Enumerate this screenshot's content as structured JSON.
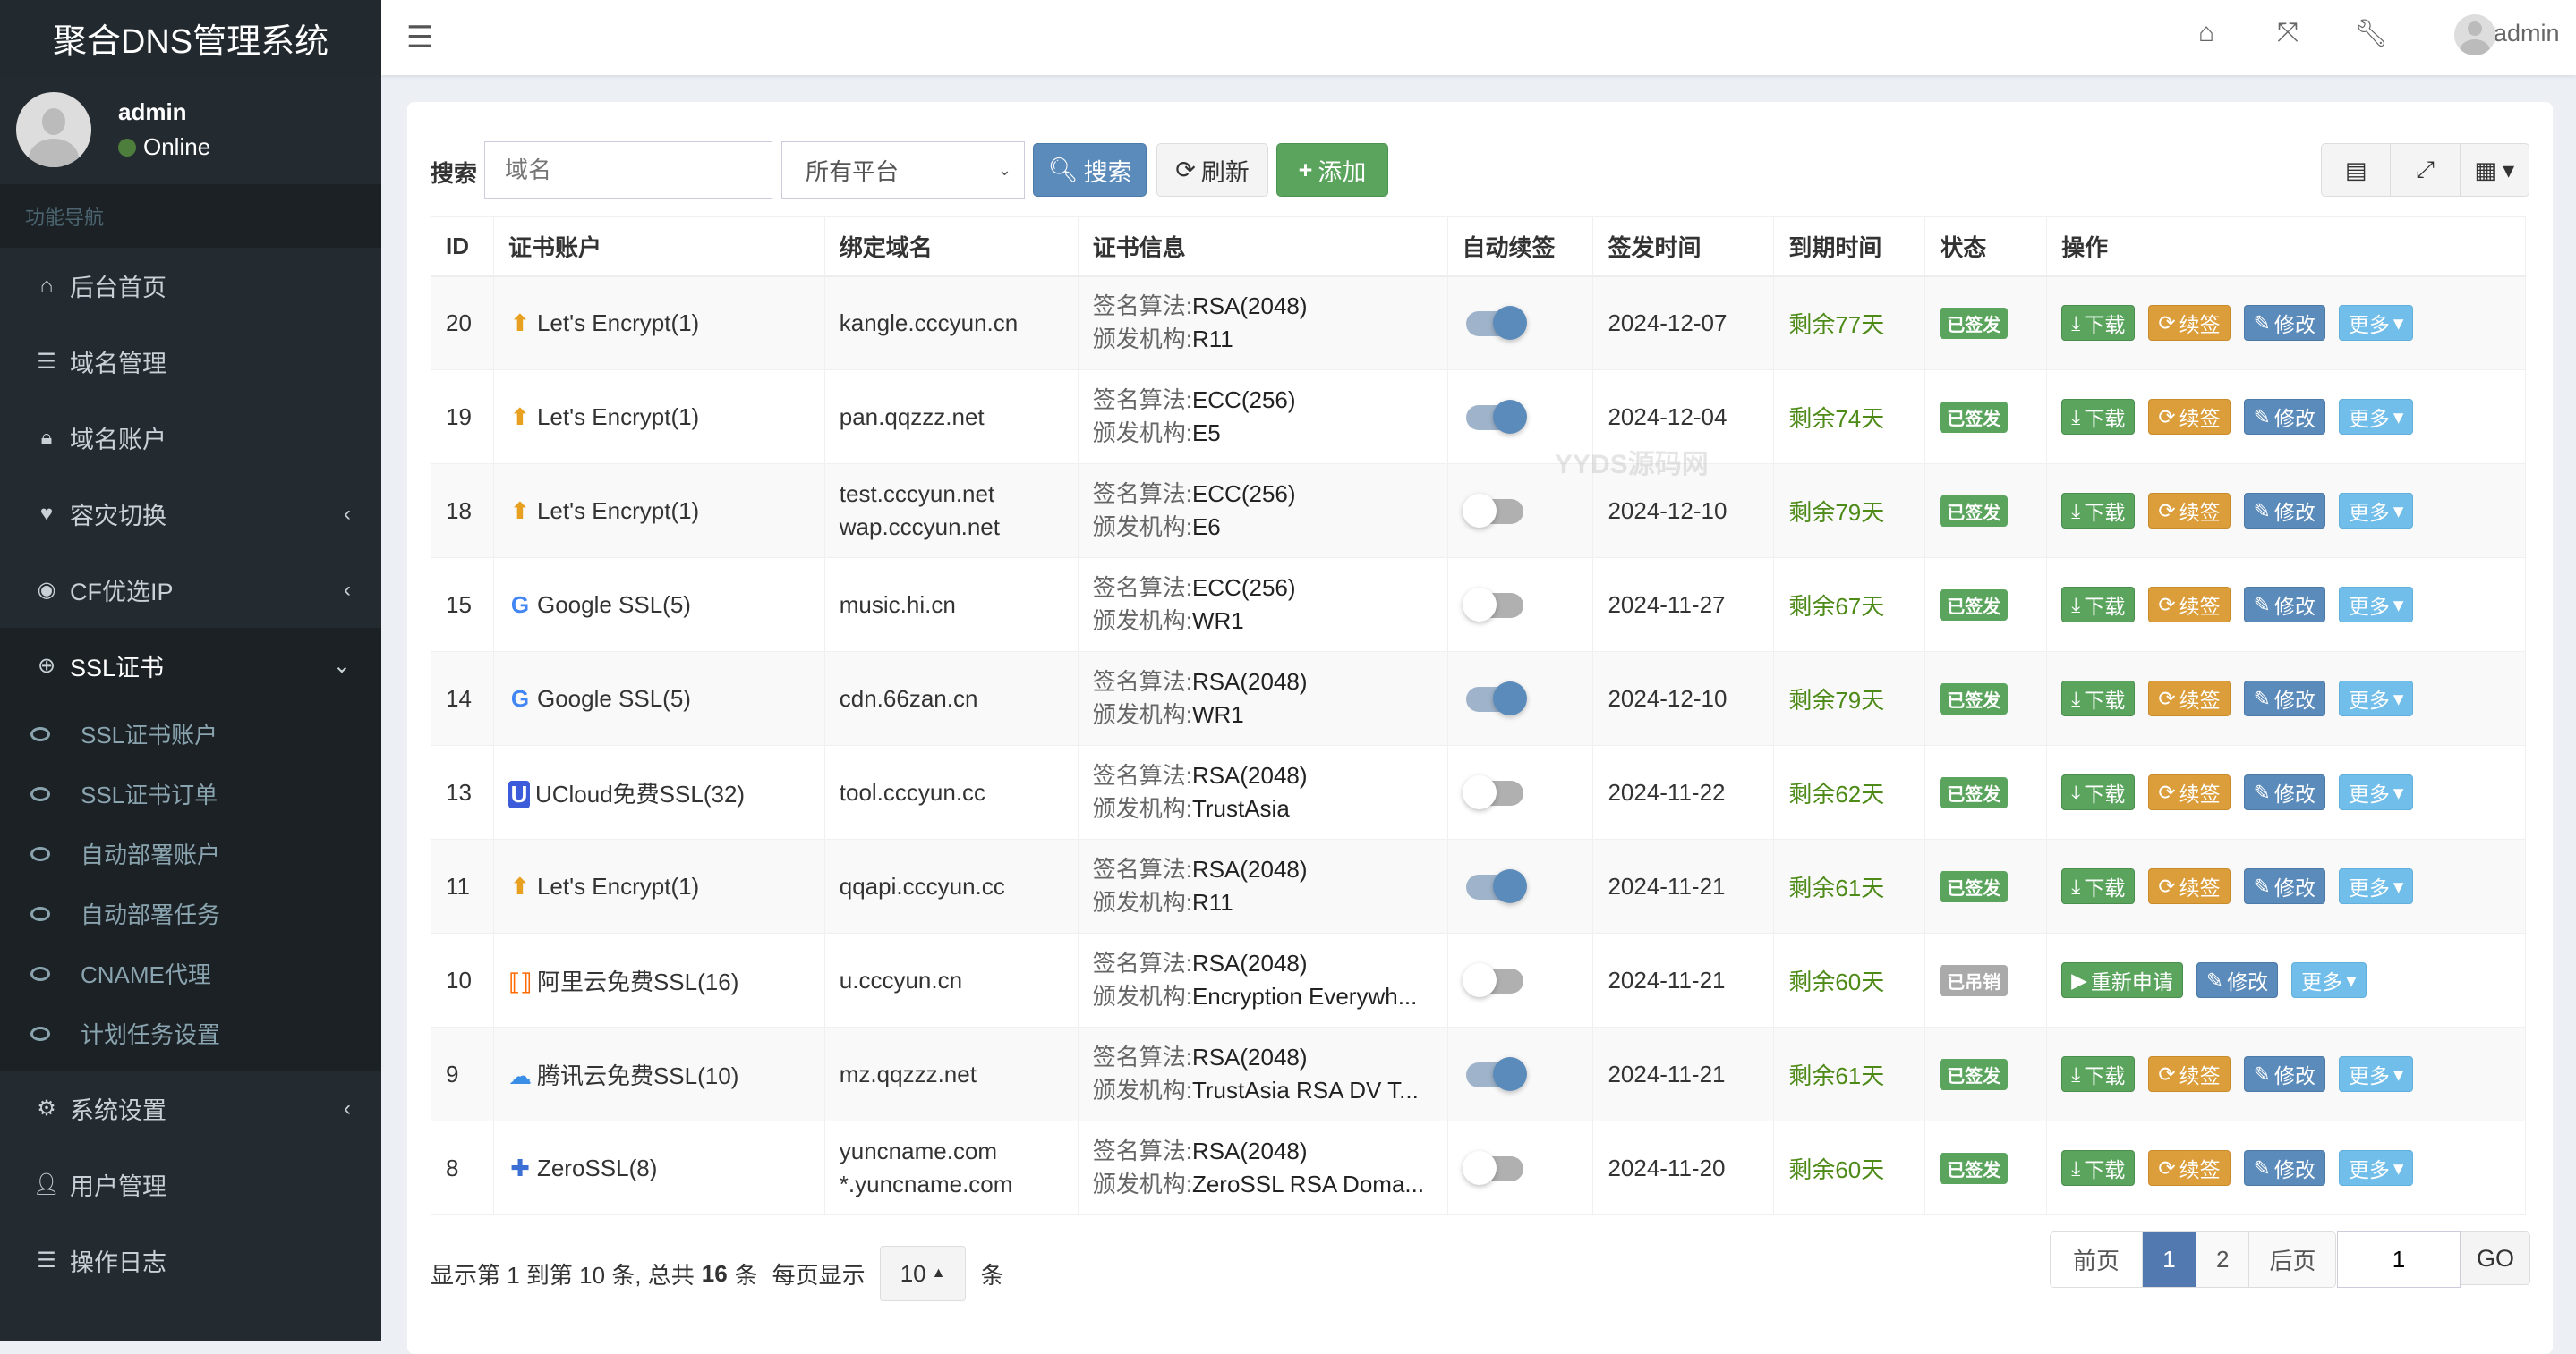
{
  "app": {
    "title": "聚合DNS管理系统",
    "watermark": "YYDS源码网"
  },
  "user": {
    "name": "admin",
    "status": "Online"
  },
  "sidebar": {
    "heading": "功能导航",
    "items": [
      {
        "label": "后台首页",
        "icon": "home-icon",
        "glyph": "⌂",
        "chev": ""
      },
      {
        "label": "域名管理",
        "icon": "list-icon",
        "glyph": "☰",
        "chev": ""
      },
      {
        "label": "域名账户",
        "icon": "lock-icon",
        "glyph": "🔒︎",
        "chev": ""
      },
      {
        "label": "容灾切换",
        "icon": "heartbeat-icon",
        "glyph": "♥",
        "chev": "‹"
      },
      {
        "label": "CF优选IP",
        "icon": "globe-icon",
        "glyph": "◉",
        "chev": "‹"
      },
      {
        "label": "SSL证书",
        "icon": "ssl-lock-icon",
        "glyph": "⊕",
        "chev": "⌄",
        "active": true
      },
      {
        "label": "系统设置",
        "icon": "gears-icon",
        "glyph": "⚙",
        "chev": "‹"
      },
      {
        "label": "用户管理",
        "icon": "user-icon",
        "glyph": "👤︎",
        "chev": ""
      },
      {
        "label": "操作日志",
        "icon": "log-list-icon",
        "glyph": "☰",
        "chev": ""
      }
    ],
    "ssl_sub": [
      "SSL证书账户",
      "SSL证书订单",
      "自动部署账户",
      "自动部署任务",
      "CNAME代理",
      "计划任务设置"
    ]
  },
  "header": {
    "user": "admin",
    "icons": [
      "home-icon",
      "fullscreen-icon",
      "wrench-icon"
    ]
  },
  "toolbar": {
    "search_label": "搜索",
    "search_placeholder": "域名",
    "platform_select": "所有平台",
    "search_btn": "搜索",
    "refresh_btn": "刷新",
    "add_btn": "添加",
    "right_icons": [
      "list-view-icon",
      "fullscreen-icon",
      "columns-icon"
    ]
  },
  "table": {
    "columns": [
      "ID",
      "证书账户",
      "绑定域名",
      "证书信息",
      "自动续签",
      "签发时间",
      "到期时间",
      "状态",
      "操作"
    ],
    "algo_prefix": "签名算法:",
    "issuer_prefix": "颁发机构:",
    "rows": [
      {
        "id": "20",
        "account": "Let's Encrypt(1)",
        "acct_icon": "letsencrypt",
        "domains": [
          "kangle.cccyun.cn"
        ],
        "algo": "RSA(2048)",
        "issuer": "R11",
        "auto": true,
        "issued": "2024-12-07",
        "remain": "剩余77天",
        "status": "已签发"
      },
      {
        "id": "19",
        "account": "Let's Encrypt(1)",
        "acct_icon": "letsencrypt",
        "domains": [
          "pan.qqzzz.net"
        ],
        "algo": "ECC(256)",
        "issuer": "E5",
        "auto": true,
        "issued": "2024-12-04",
        "remain": "剩余74天",
        "status": "已签发"
      },
      {
        "id": "18",
        "account": "Let's Encrypt(1)",
        "acct_icon": "letsencrypt",
        "domains": [
          "test.cccyun.net",
          "wap.cccyun.net"
        ],
        "algo": "ECC(256)",
        "issuer": "E6",
        "auto": false,
        "issued": "2024-12-10",
        "remain": "剩余79天",
        "status": "已签发"
      },
      {
        "id": "15",
        "account": "Google SSL(5)",
        "acct_icon": "google",
        "domains": [
          "music.hi.cn"
        ],
        "algo": "ECC(256)",
        "issuer": "WR1",
        "auto": false,
        "issued": "2024-11-27",
        "remain": "剩余67天",
        "status": "已签发"
      },
      {
        "id": "14",
        "account": "Google SSL(5)",
        "acct_icon": "google",
        "domains": [
          "cdn.66zan.cn"
        ],
        "algo": "RSA(2048)",
        "issuer": "WR1",
        "auto": true,
        "issued": "2024-12-10",
        "remain": "剩余79天",
        "status": "已签发"
      },
      {
        "id": "13",
        "account": "UCloud免费SSL(32)",
        "acct_icon": "ucloud",
        "domains": [
          "tool.cccyun.cc"
        ],
        "algo": "RSA(2048)",
        "issuer": "TrustAsia",
        "auto": false,
        "issued": "2024-11-22",
        "remain": "剩余62天",
        "status": "已签发"
      },
      {
        "id": "11",
        "account": "Let's Encrypt(1)",
        "acct_icon": "letsencrypt",
        "domains": [
          "qqapi.cccyun.cc"
        ],
        "algo": "RSA(2048)",
        "issuer": "R11",
        "auto": true,
        "issued": "2024-11-21",
        "remain": "剩余61天",
        "status": "已签发"
      },
      {
        "id": "10",
        "account": "阿里云免费SSL(16)",
        "acct_icon": "aliyun",
        "domains": [
          "u.cccyun.cn"
        ],
        "algo": "RSA(2048)",
        "issuer": "Encryption Everywh...",
        "auto": false,
        "issued": "2024-11-21",
        "remain": "剩余60天",
        "status": "已吊销",
        "revoked": true
      },
      {
        "id": "9",
        "account": "腾讯云免费SSL(10)",
        "acct_icon": "tencent",
        "domains": [
          "mz.qqzzz.net"
        ],
        "algo": "RSA(2048)",
        "issuer": "TrustAsia RSA DV T...",
        "auto": true,
        "issued": "2024-11-21",
        "remain": "剩余61天",
        "status": "已签发"
      },
      {
        "id": "8",
        "account": "ZeroSSL(8)",
        "acct_icon": "zerossl",
        "domains": [
          "yuncname.com",
          "*.yuncname.com"
        ],
        "algo": "RSA(2048)",
        "issuer": "ZeroSSL RSA Doma...",
        "auto": false,
        "issued": "2024-11-20",
        "remain": "剩余60天",
        "status": "已签发"
      }
    ],
    "actions": {
      "download": "下载",
      "renew": "续签",
      "edit": "修改",
      "more": "更多",
      "reapply": "重新申请"
    }
  },
  "footer": {
    "showing_pre": "显示第 1 到第 10 条, 总共",
    "total": "16",
    "showing_post": "条",
    "per_page_label": "每页显示",
    "per_page": "10",
    "per_page_unit": "条"
  },
  "pagination": {
    "prev": "前页",
    "pages": [
      "1",
      "2"
    ],
    "current": "1",
    "next": "后页",
    "goto_value": "1",
    "go": "GO"
  },
  "colors": {
    "primary": "#5b8bbb",
    "success": "#5aa45d",
    "warning": "#dc9e3a",
    "info": "#72beea",
    "revoked": "#aaaaaa",
    "remain": "#4d8a17",
    "sidebar": "#242b30"
  }
}
